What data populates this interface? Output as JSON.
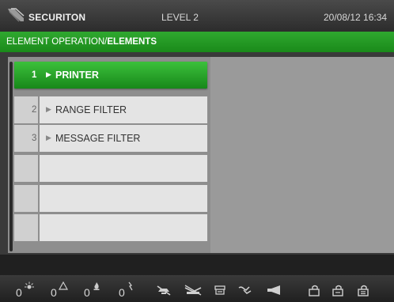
{
  "header": {
    "brand": "SECURITON",
    "level": "LEVEL 2",
    "datetime": "20/08/12 16:34"
  },
  "breadcrumb": {
    "prefix": "ELEMENT OPERATION/",
    "current": "ELEMENTS"
  },
  "list": {
    "items": [
      {
        "number": "1",
        "label": "PRINTER",
        "selected": true
      },
      {
        "number": "2",
        "label": "RANGE FILTER",
        "selected": false
      },
      {
        "number": "3",
        "label": "MESSAGE FILTER",
        "selected": false
      },
      {
        "number": "",
        "label": "",
        "selected": false
      },
      {
        "number": "",
        "label": "",
        "selected": false
      },
      {
        "number": "",
        "label": "",
        "selected": false
      }
    ]
  },
  "status": {
    "counters": [
      {
        "icon": "alarm-icon",
        "value": "0"
      },
      {
        "icon": "warning-icon",
        "value": "0"
      },
      {
        "icon": "fire-icon",
        "value": "0"
      },
      {
        "icon": "fault-icon",
        "value": "0"
      }
    ],
    "icons": [
      "detector-off-icon",
      "zone-off-icon",
      "device-icon",
      "output-icon",
      "horn-icon",
      "lock-icon-1",
      "lock-icon-2",
      "lock-icon-3"
    ]
  },
  "colors": {
    "accent_green": "#1f9a1f",
    "header_gray": "#3a3a3a"
  }
}
